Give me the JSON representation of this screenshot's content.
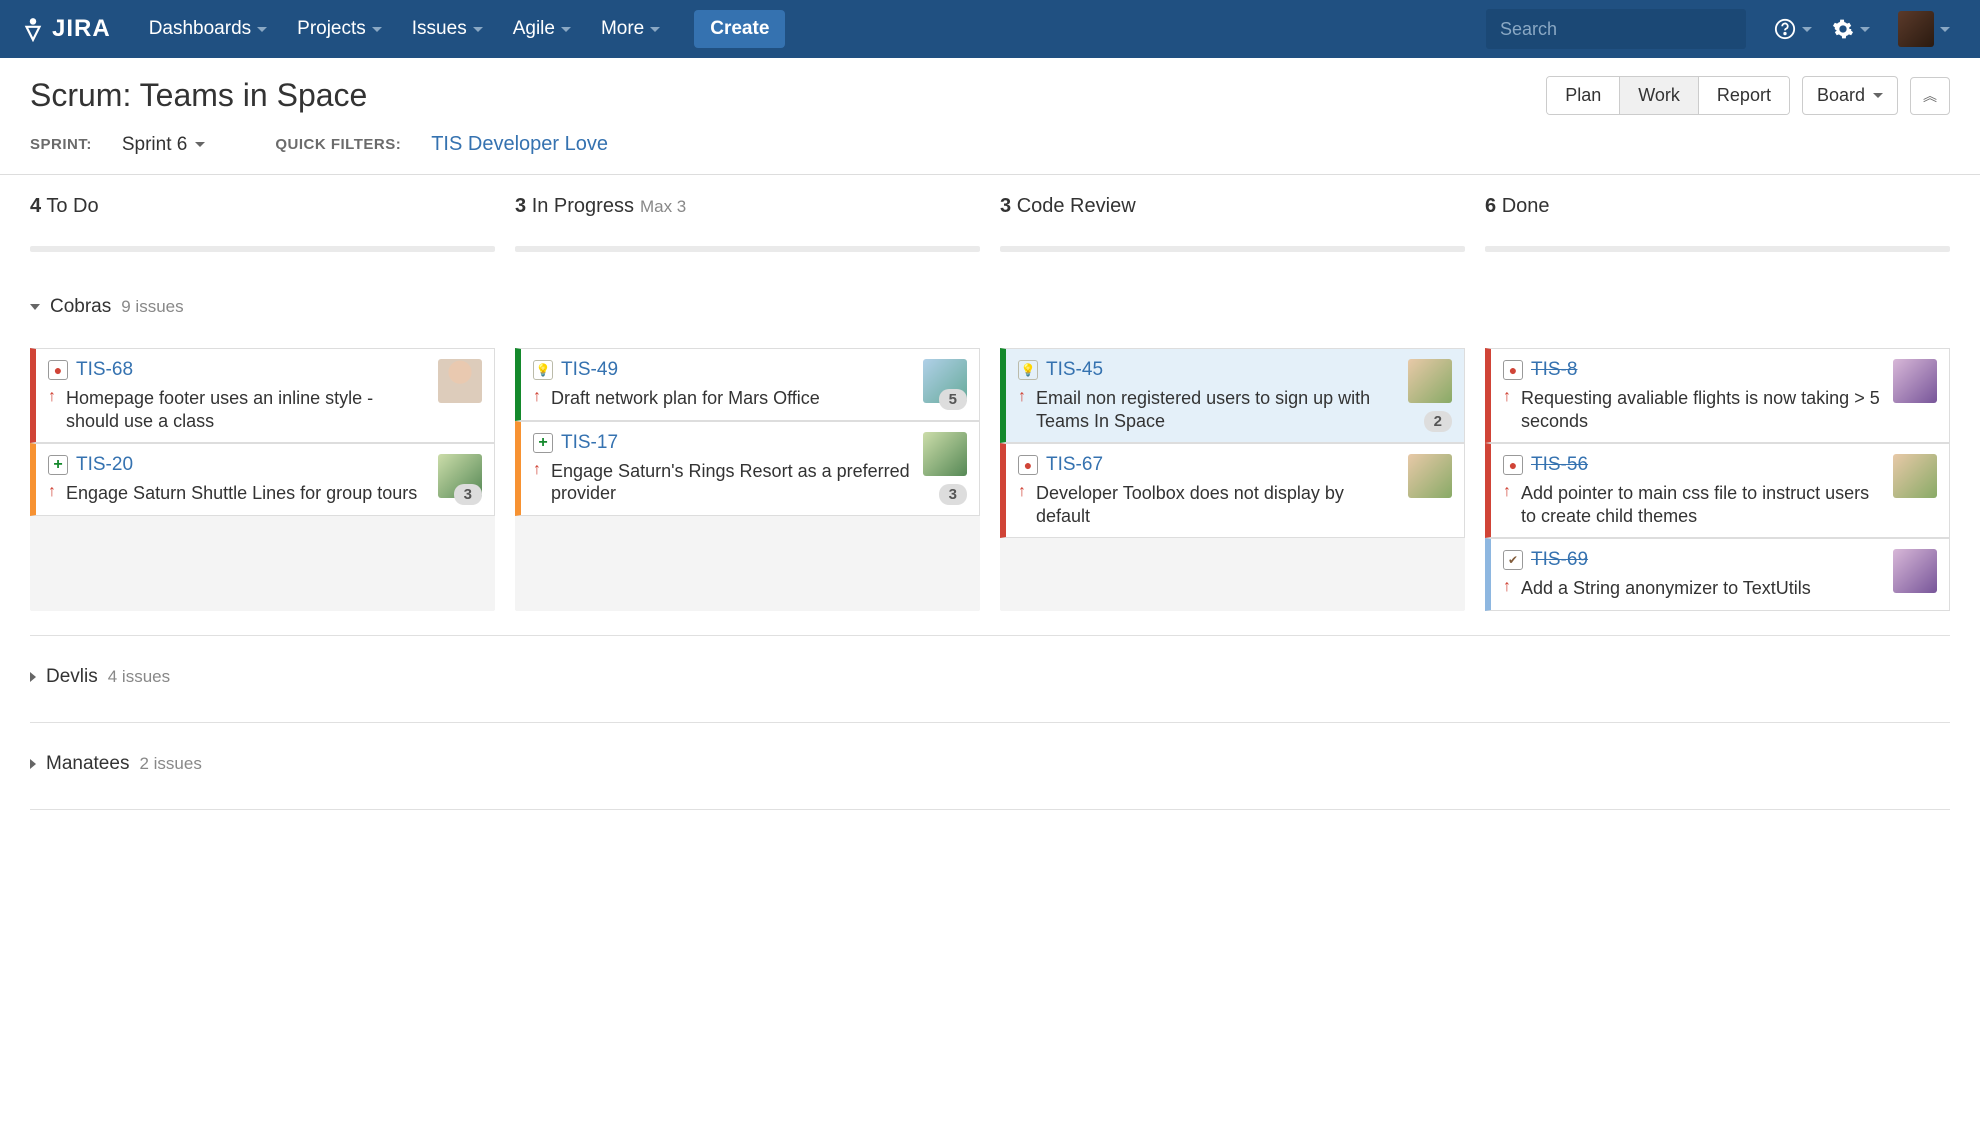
{
  "nav": {
    "logo": "JIRA",
    "items": [
      "Dashboards",
      "Projects",
      "Issues",
      "Agile",
      "More"
    ],
    "create": "Create",
    "search_placeholder": "Search"
  },
  "header": {
    "title": "Scrum: Teams in Space",
    "tabs": {
      "plan": "Plan",
      "work": "Work",
      "report": "Report"
    },
    "board_btn": "Board",
    "sprint_label": "SPRINT:",
    "sprint_value": "Sprint 6",
    "filters_label": "QUICK FILTERS:",
    "filter_link": "TIS Developer Love"
  },
  "columns": [
    {
      "count": "4",
      "name": "To Do"
    },
    {
      "count": "3",
      "name": "In Progress",
      "max": "Max 3"
    },
    {
      "count": "3",
      "name": "Code Review"
    },
    {
      "count": "6",
      "name": "Done"
    }
  ],
  "swimlanes": [
    {
      "name": "Cobras",
      "issues_label": "9 issues",
      "expanded": true,
      "cards": {
        "0": [
          {
            "key": "TIS-68",
            "type": "bug",
            "stripe": "red",
            "summary": "Homepage footer uses an inline style - should use a class",
            "avatar": "av1"
          },
          {
            "key": "TIS-20",
            "type": "story",
            "stripe": "orange",
            "summary": "Engage Saturn Shuttle Lines for group tours",
            "avatar": "av3",
            "badge": "3"
          }
        ],
        "1": [
          {
            "key": "TIS-49",
            "type": "idea",
            "stripe": "green",
            "summary": "Draft network plan for Mars Office",
            "avatar": "av2",
            "badge": "5"
          },
          {
            "key": "TIS-17",
            "type": "story",
            "stripe": "orange",
            "summary": "Engage Saturn's Rings Resort as a preferred provider",
            "avatar": "av3",
            "badge": "3"
          }
        ],
        "2": [
          {
            "key": "TIS-45",
            "type": "idea",
            "stripe": "green",
            "summary": "Email non registered users to sign up with Teams In Space",
            "avatar": "av4",
            "badge": "2",
            "selected": true
          },
          {
            "key": "TIS-67",
            "type": "bug",
            "stripe": "red",
            "summary": "Developer Toolbox does not display by default",
            "avatar": "av4"
          }
        ],
        "3": [
          {
            "key": "TIS-8",
            "type": "bug",
            "stripe": "red",
            "summary": "Requesting avaliable flights is now taking > 5 seconds",
            "avatar": "av5",
            "done": true
          },
          {
            "key": "TIS-56",
            "type": "bug",
            "stripe": "red",
            "summary": "Add pointer to main css file to instruct users to create child themes",
            "avatar": "av4",
            "done": true
          },
          {
            "key": "TIS-69",
            "type": "task",
            "stripe": "lightblue",
            "summary": "Add a String anonymizer to TextUtils",
            "avatar": "av5",
            "done": true
          }
        ]
      }
    },
    {
      "name": "Devlis",
      "issues_label": "4 issues",
      "expanded": false
    },
    {
      "name": "Manatees",
      "issues_label": "2 issues",
      "expanded": false
    }
  ]
}
